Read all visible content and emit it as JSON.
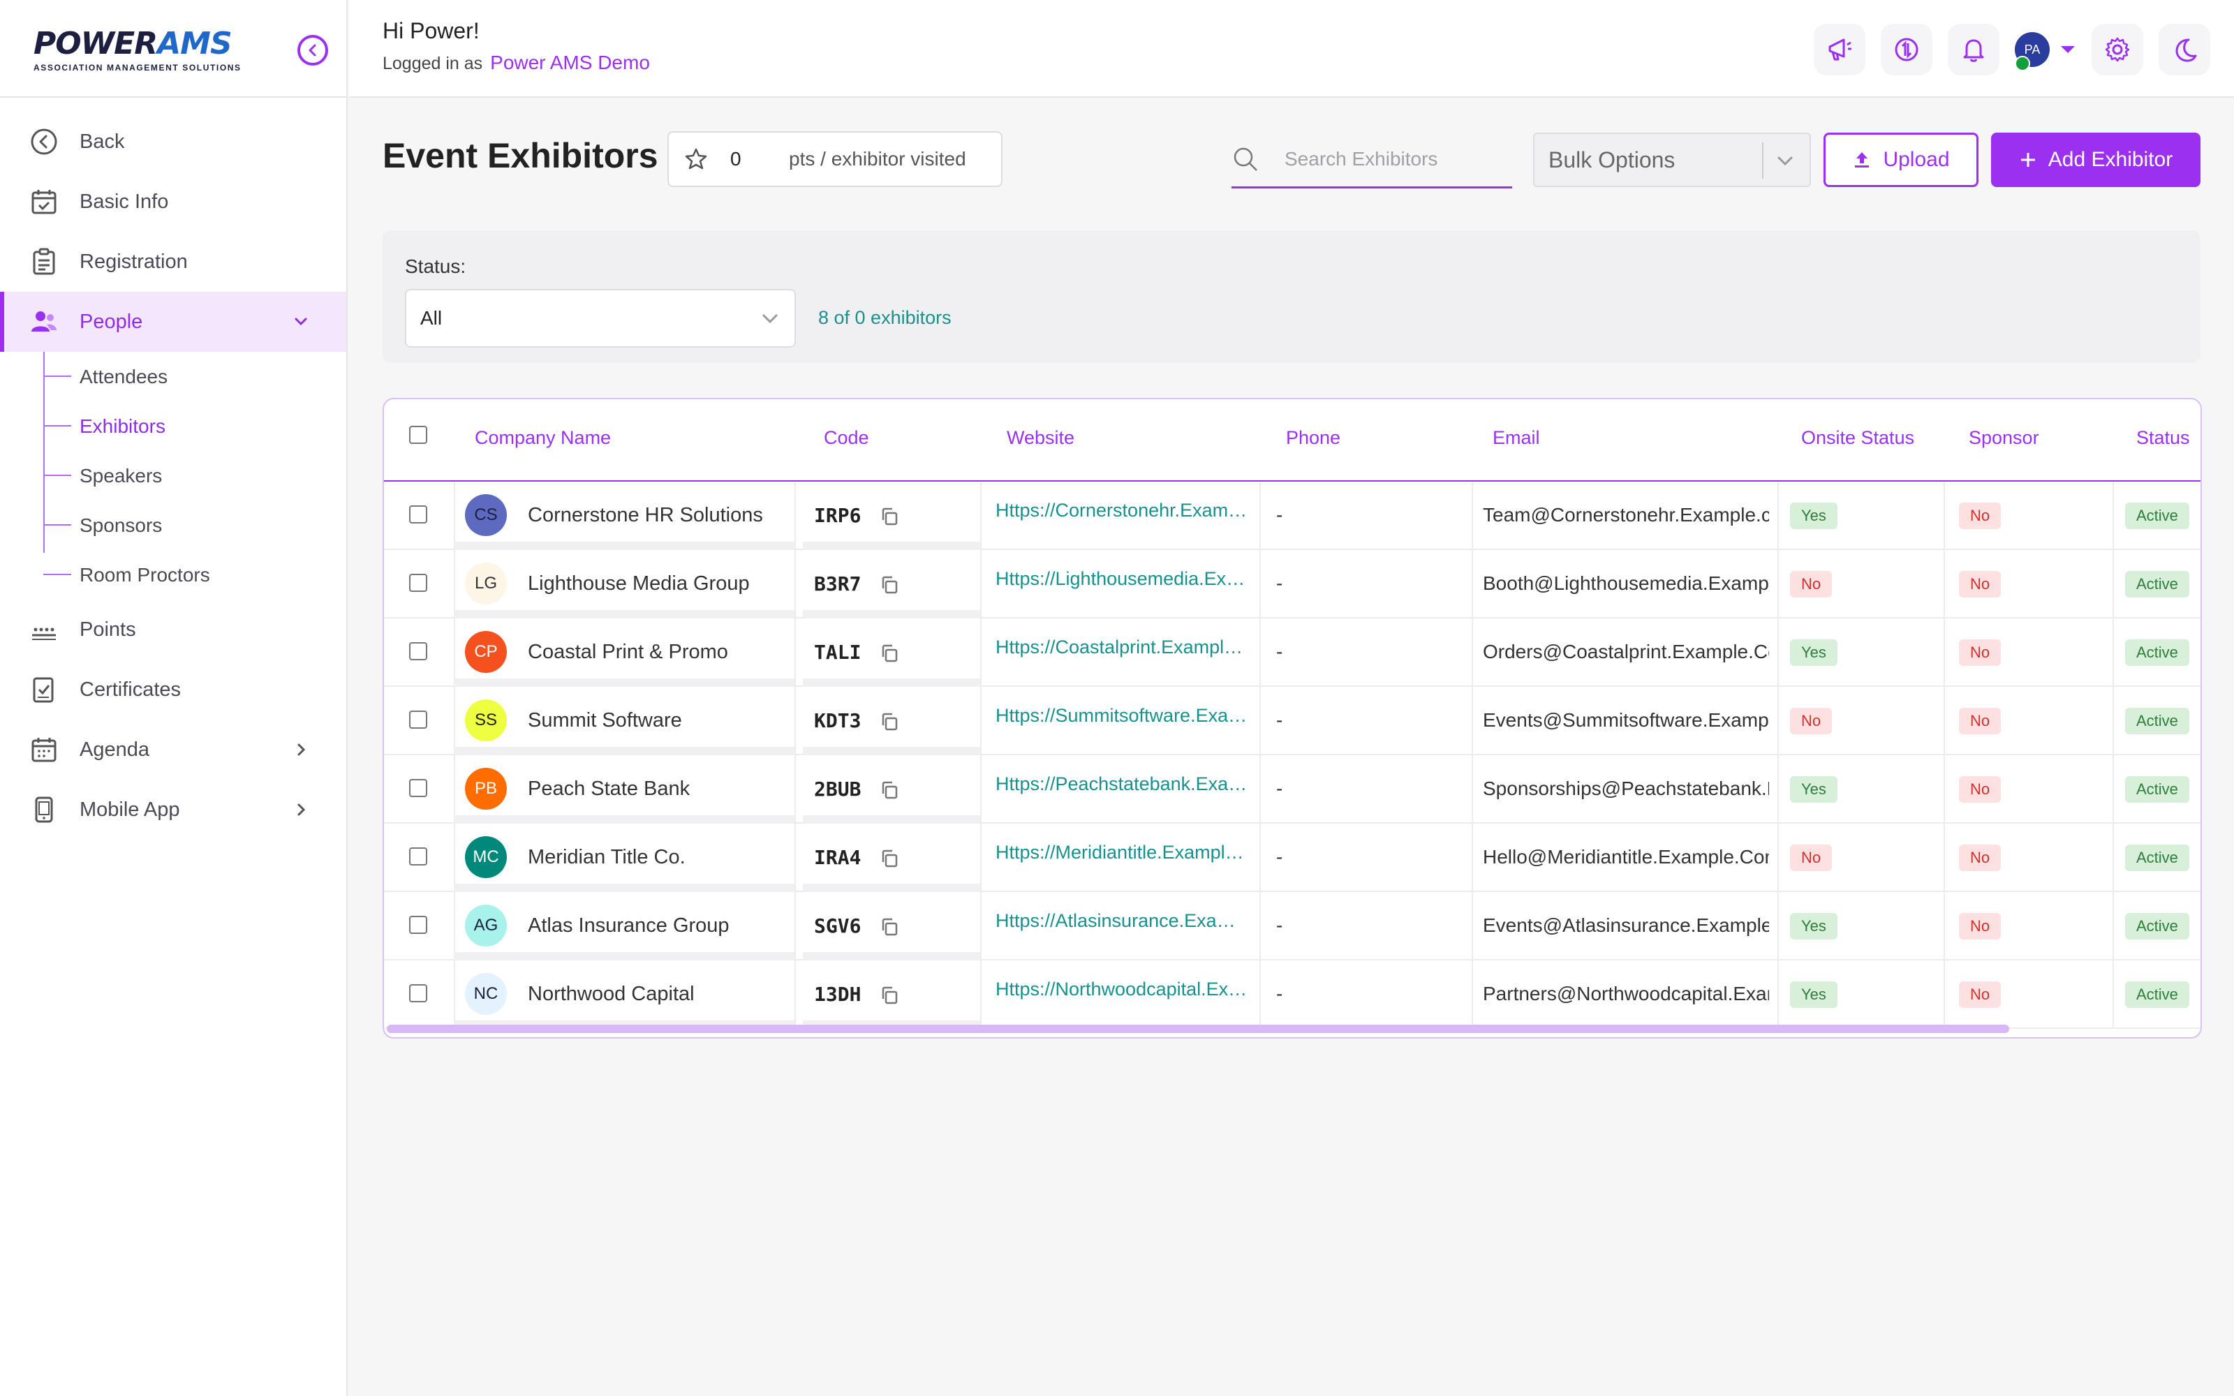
{
  "brand": {
    "name_part1": "POWER",
    "name_part2": "AMS",
    "tagline": "ASSOCIATION MANAGEMENT SOLUTIONS"
  },
  "sidebar": {
    "items": [
      {
        "label": "Back",
        "icon": "back-circle-icon"
      },
      {
        "label": "Basic Info",
        "icon": "calendar-check-icon"
      },
      {
        "label": "Registration",
        "icon": "clipboard-icon"
      },
      {
        "label": "People",
        "icon": "people-icon",
        "active": true,
        "expanded": true
      },
      {
        "label": "Points",
        "icon": "points-icon"
      },
      {
        "label": "Certificates",
        "icon": "certificate-icon"
      },
      {
        "label": "Agenda",
        "icon": "calendar-icon"
      },
      {
        "label": "Mobile App",
        "icon": "mobile-icon"
      }
    ],
    "people_sub": [
      "Attendees",
      "Exhibitors",
      "Speakers",
      "Sponsors",
      "Room Proctors"
    ],
    "active_sub": "Exhibitors"
  },
  "header": {
    "greeting": "Hi Power!",
    "logged_prefix": "Logged in as",
    "account": "Power AMS Demo",
    "avatar_initials": "PA"
  },
  "page": {
    "title": "Event Exhibitors",
    "pts_value": "0",
    "pts_label": "pts / exhibitor visited",
    "search_placeholder": "Search Exhibitors",
    "bulk_label": "Bulk Options",
    "upload_label": "Upload",
    "add_label": "Add Exhibitor"
  },
  "filter": {
    "status_label": "Status:",
    "status_value": "All",
    "count_text": "8 of 0 exhibitors"
  },
  "table": {
    "columns": [
      "Company Name",
      "Code",
      "Website",
      "Phone",
      "Email",
      "Onsite Status",
      "Sponsor",
      "Status"
    ],
    "rows": [
      {
        "initials": "CS",
        "color": "#5c6bc0",
        "text_color": "#1c1f3f",
        "company": "Cornerstone HR Solutions",
        "code": "IRP6",
        "website": "Https://Cornerstonehr.Example.com",
        "phone": "-",
        "email": "Team@Cornerstonehr.Example.com",
        "onsite": "Yes",
        "sponsor": "No",
        "status": "Active"
      },
      {
        "initials": "LG",
        "color": "#fdf5e6",
        "text_color": "#333333",
        "company": "Lighthouse Media Group",
        "code": "B3R7",
        "website": "Https://Lighthousemedia.Example.com",
        "phone": "-",
        "email": "Booth@Lighthousemedia.Example.com",
        "onsite": "No",
        "sponsor": "No",
        "status": "Active"
      },
      {
        "initials": "CP",
        "color": "#f4511e",
        "text_color": "#ffffff",
        "company": "Coastal Print & Promo",
        "code": "TALI",
        "website": "Https://Coastalprint.Example.com",
        "phone": "-",
        "email": "Orders@Coastalprint.Example.Com",
        "onsite": "Yes",
        "sponsor": "No",
        "status": "Active"
      },
      {
        "initials": "SS",
        "color": "#eeff41",
        "text_color": "#222222",
        "company": "Summit Software",
        "code": "KDT3",
        "website": "Https://Summitsoftware.Example.com",
        "phone": "-",
        "email": "Events@Summitsoftware.Example.com",
        "onsite": "No",
        "sponsor": "No",
        "status": "Active"
      },
      {
        "initials": "PB",
        "color": "#ff6d00",
        "text_color": "#ffffff",
        "company": "Peach State Bank",
        "code": "2BUB",
        "website": "Https://Peachstatebank.Example.com",
        "phone": "-",
        "email": "Sponsorships@Peachstatebank.Example.com",
        "onsite": "Yes",
        "sponsor": "No",
        "status": "Active"
      },
      {
        "initials": "MC",
        "color": "#00897b",
        "text_color": "#ffffff",
        "company": "Meridian Title Co.",
        "code": "IRA4",
        "website": "Https://Meridiantitle.Example.com",
        "phone": "-",
        "email": "Hello@Meridiantitle.Example.Com",
        "onsite": "No",
        "sponsor": "No",
        "status": "Active"
      },
      {
        "initials": "AG",
        "color": "#a7f3eb",
        "text_color": "#1c1f3f",
        "company": "Atlas Insurance Group",
        "code": "SGV6",
        "website": "Https://Atlasinsurance.Example.com",
        "phone": "-",
        "email": "Events@Atlasinsurance.Example.com",
        "onsite": "Yes",
        "sponsor": "No",
        "status": "Active"
      },
      {
        "initials": "NC",
        "color": "#e3f2fd",
        "text_color": "#1c1f3f",
        "company": "Northwood Capital",
        "code": "13DH",
        "website": "Https://Northwoodcapital.Example.com",
        "phone": "-",
        "email": "Partners@Northwoodcapital.Example.com",
        "onsite": "Yes",
        "sponsor": "No",
        "status": "Active"
      }
    ]
  },
  "colors": {
    "accent": "#9b30f0",
    "link": "#17918e",
    "yes_bg": "#d8f0da",
    "no_bg": "#fde0e0"
  }
}
